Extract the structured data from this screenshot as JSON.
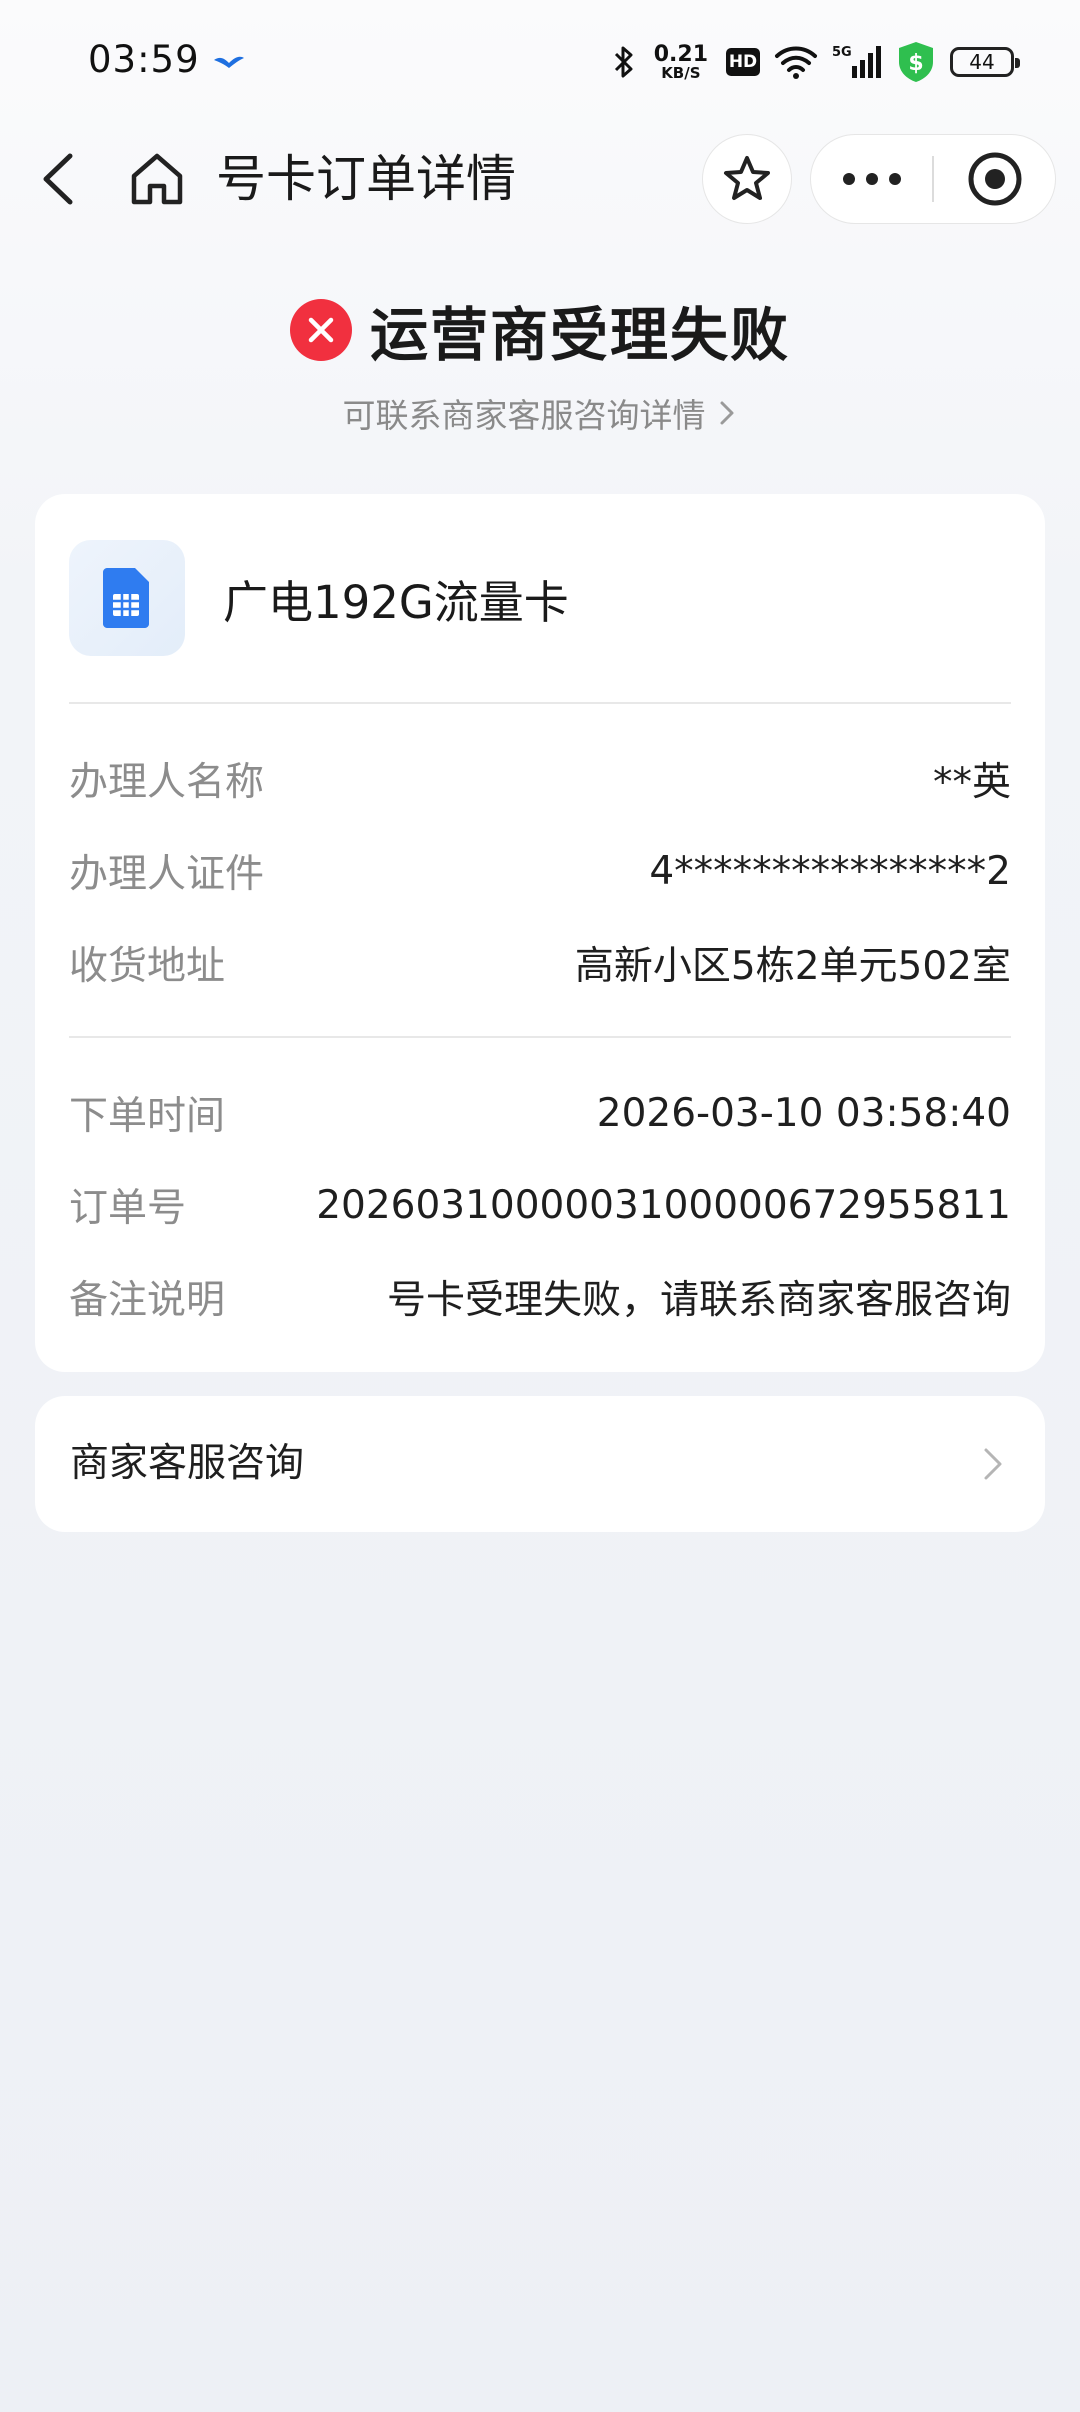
{
  "status_bar": {
    "time": "03:59",
    "network_speed_value": "0.21",
    "network_speed_unit": "KB/S",
    "hd_label": "HD",
    "signal_label": "5G",
    "battery": "44",
    "icons": [
      "bird-notification-icon",
      "bluetooth-icon",
      "wifi-icon",
      "signal-icon",
      "shield-dollar-icon",
      "battery-icon"
    ]
  },
  "nav": {
    "title": "号卡订单详情",
    "icons": [
      "back-icon",
      "home-icon",
      "star-icon",
      "more-icon",
      "close-circle-icon"
    ]
  },
  "status": {
    "title": "运营商受理失败",
    "hint": "可联系商家客服咨询详情",
    "hint_arrow": "›"
  },
  "product": {
    "name": "广电192G流量卡",
    "icon": "sim-card-icon"
  },
  "details": [
    {
      "label": "办理人名称",
      "value": "**英"
    },
    {
      "label": "办理人证件",
      "value": "4****************2"
    },
    {
      "label": "收货地址",
      "value": "高新小区5栋2单元502室"
    },
    {
      "label": "下单时间",
      "value": "2026-03-10 03:58:40"
    },
    {
      "label": "订单号",
      "value": "20260310000031000006729558 11"
    },
    {
      "label": "备注说明",
      "value": "号卡受理失败，请联系商家客服咨询"
    }
  ],
  "service": {
    "label": "商家客服咨询"
  },
  "colors": {
    "error_red": "#f1303f",
    "sim_blue": "#2f7cf0",
    "shield_green": "#2fbf4f",
    "background": "#edf0f5"
  }
}
